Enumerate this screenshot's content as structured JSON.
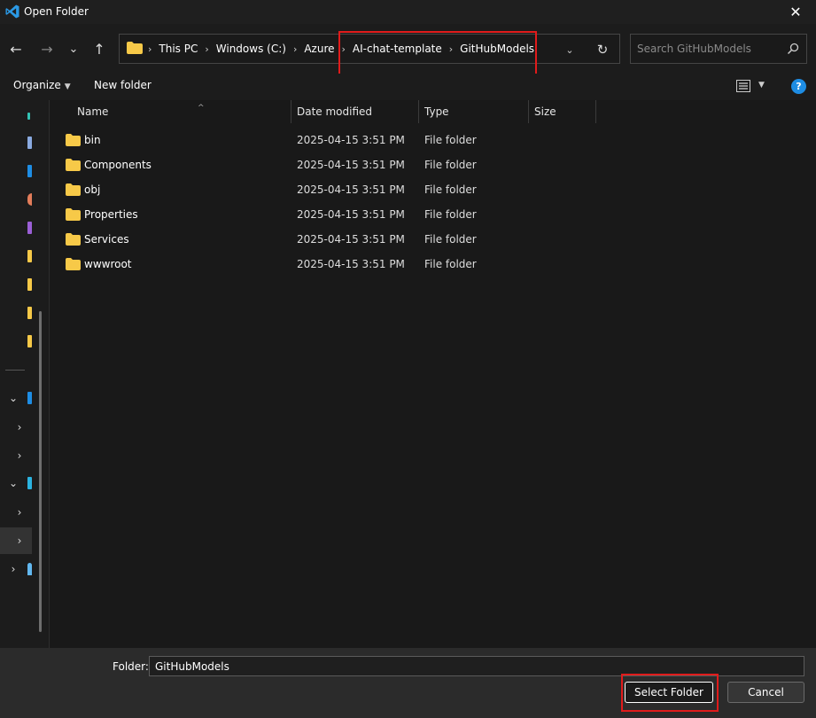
{
  "window": {
    "title": "Open Folder",
    "close_glyph": "✕"
  },
  "nav": {
    "back_glyph": "←",
    "forward_glyph": "→",
    "recent_glyph": "⌄",
    "up_glyph": "↑"
  },
  "address": {
    "crumbs": [
      "This PC",
      "Windows (C:)",
      "Azure",
      "AI-chat-template",
      "GitHubModels"
    ],
    "separator": "›",
    "dropdown_glyph": "⌄",
    "refresh_glyph": "↻"
  },
  "search": {
    "placeholder": "Search GitHubModels"
  },
  "toolbar": {
    "organize_label": "Organize",
    "organize_caret": "▼",
    "new_folder_label": "New folder",
    "view_caret": "▼",
    "help_glyph": "?"
  },
  "columns": {
    "name": "Name",
    "date_modified": "Date modified",
    "type": "Type",
    "size": "Size",
    "sort_caret": "^"
  },
  "files": [
    {
      "name": "bin",
      "date": "2025-04-15 3:51 PM",
      "type": "File folder"
    },
    {
      "name": "Components",
      "date": "2025-04-15 3:51 PM",
      "type": "File folder"
    },
    {
      "name": "obj",
      "date": "2025-04-15 3:51 PM",
      "type": "File folder"
    },
    {
      "name": "Properties",
      "date": "2025-04-15 3:51 PM",
      "type": "File folder"
    },
    {
      "name": "Services",
      "date": "2025-04-15 3:51 PM",
      "type": "File folder"
    },
    {
      "name": "wwwroot",
      "date": "2025-04-15 3:51 PM",
      "type": "File folder"
    }
  ],
  "navpane": {
    "chevrons": [
      "⌄",
      "›",
      "›",
      "⌄",
      "›",
      "›",
      "›"
    ]
  },
  "footer": {
    "folder_label": "Folder:",
    "folder_value": "GitHubModels",
    "select_label": "Select Folder",
    "cancel_label": "Cancel"
  },
  "colors": {
    "highlight": "#e01b1b",
    "folder": "#f7c948",
    "accent": "#1e8de4"
  }
}
